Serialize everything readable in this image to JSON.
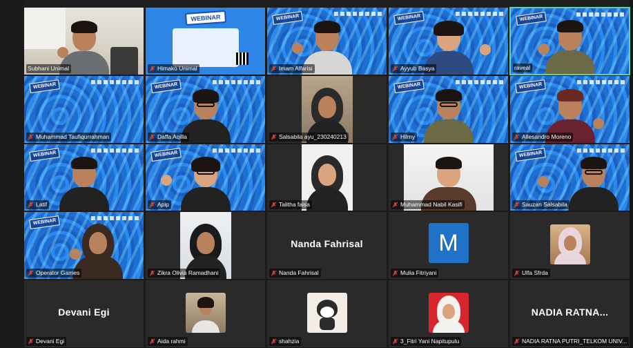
{
  "meeting": {
    "participants": [
      {
        "name": "Subhani Unimal",
        "muted": false
      },
      {
        "name": "Himako Unimal",
        "muted": true
      },
      {
        "name": "Imam Alfarisi",
        "muted": true
      },
      {
        "name": "Ayyub Basya",
        "muted": true
      },
      {
        "name": "raveal",
        "muted": false,
        "active_speaker": true
      },
      {
        "name": "Muhammad Taufiqurrahman",
        "muted": true
      },
      {
        "name": "Daffa Aqilla",
        "muted": true
      },
      {
        "name": "Salsabila ayu_230240213",
        "muted": true
      },
      {
        "name": "Hilmy",
        "muted": true
      },
      {
        "name": "Allesandro Moreno",
        "muted": true
      },
      {
        "name": "Latif",
        "muted": true
      },
      {
        "name": "Apip",
        "muted": true
      },
      {
        "name": "Talitha faisa",
        "muted": true
      },
      {
        "name": "Muhammad Nabil Kasifi",
        "muted": true
      },
      {
        "name": "Sauzan Salsabila",
        "muted": true
      },
      {
        "name": "Operator Games",
        "muted": true
      },
      {
        "name": "Zikra Olivia Ramadhani",
        "muted": true
      },
      {
        "name": "Nanda Fahrisal",
        "muted": true,
        "display_name": "Nanda Fahrisal"
      },
      {
        "name": "Mulia Fitriyani",
        "muted": true,
        "avatar_letter": "M"
      },
      {
        "name": "Ulfa Sfrda",
        "muted": true
      },
      {
        "name": "Devani Egi",
        "muted": true,
        "display_name": "Devani Egi"
      },
      {
        "name": "Aida rahmi",
        "muted": true
      },
      {
        "name": "shahzia",
        "muted": true
      },
      {
        "name": "3_Fitri Yani Napitupulu",
        "muted": true
      },
      {
        "name": "NADIA RATNA PUTRI_TELKOM UNIV...",
        "muted": true,
        "display_name": "NADIA  RATNA..."
      }
    ]
  },
  "colors": {
    "active_speaker_border": "#63d39a",
    "muted_mic": "#e0443e",
    "avatar_blue": "#1f73c6",
    "virtual_bg_blue": "#2b86ec"
  }
}
